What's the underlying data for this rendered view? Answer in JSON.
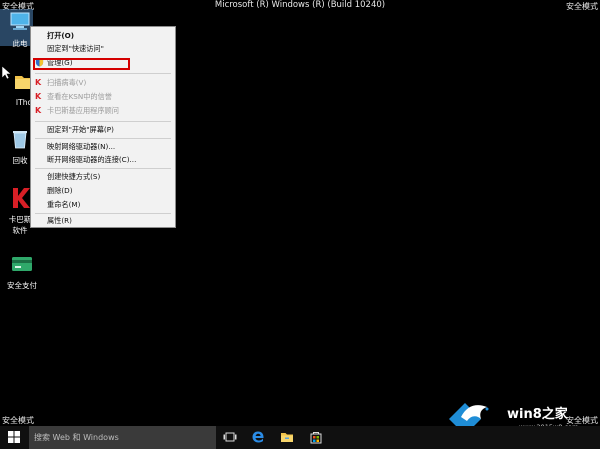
{
  "screen": {
    "corner_tl": "安全模式",
    "corner_tr": "安全模式",
    "corner_bl": "安全模式",
    "corner_br": "安全模式",
    "title": "Microsoft (R) Windows (R) (Build 10240)"
  },
  "desktop_icons": [
    {
      "label": "此电"
    },
    {
      "label": "ITho"
    },
    {
      "label": "回收"
    },
    {
      "label": "卡巴斯"
    },
    {
      "label": "软件"
    },
    {
      "label": "安全支付"
    }
  ],
  "context_menu": {
    "items": [
      {
        "label": "打开(O)",
        "bold": true
      },
      {
        "label": "固定到\"快速访问\""
      },
      {
        "label": "管理(G)"
      },
      {
        "label": "扫描病毒(V)",
        "disabled": true
      },
      {
        "label": "查看在KSN中的信誉",
        "disabled": true
      },
      {
        "label": "卡巴斯基应用程序顾问",
        "disabled": true
      },
      {
        "label": "固定到\"开始\"屏幕(P)"
      },
      {
        "label": "映射网络驱动器(N)..."
      },
      {
        "label": "断开网络驱动器的连接(C)..."
      },
      {
        "label": "创建快捷方式(S)"
      },
      {
        "label": "删除(D)"
      },
      {
        "label": "重命名(M)"
      },
      {
        "label": "属性(R)"
      }
    ]
  },
  "taskbar": {
    "search_placeholder": "搜索 Web 和 Windows"
  },
  "watermark": {
    "brand": "win8之家",
    "url": "www.2015w8.com"
  },
  "colors": {
    "highlight_border": "#d40000",
    "menu_bg": "#f2f2f2",
    "accent_blue": "#1f8dd6"
  }
}
